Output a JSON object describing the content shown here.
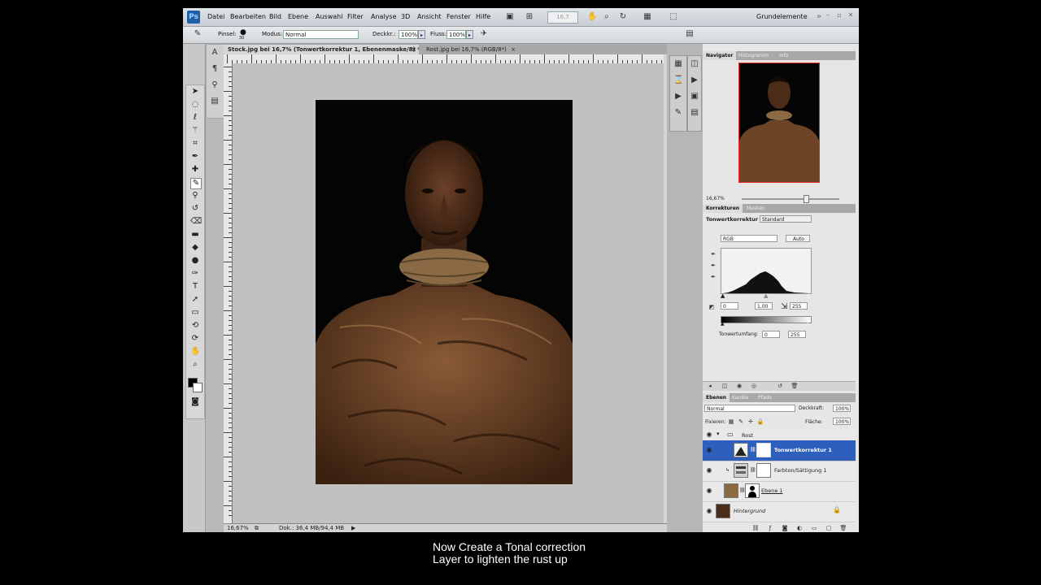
{
  "menubar": {
    "logo": "Ps",
    "items": [
      "Datei",
      "Bearbeiten",
      "Bild",
      "Ebene",
      "Auswahl",
      "Filter",
      "Analyse",
      "3D",
      "Ansicht",
      "Fenster",
      "Hilfe"
    ],
    "zoom_value": "16,7",
    "workspace": "Grundelemente",
    "window_buttons": [
      "–",
      "▫",
      "✕"
    ]
  },
  "options": {
    "tool_label": "Pinsel:",
    "brush_size": "30",
    "mode_label": "Modus:",
    "mode_value": "Normal",
    "opacity_label": "Deckkr.:",
    "opacity_value": "100%",
    "flow_label": "Fluss:",
    "flow_value": "100%"
  },
  "tabs": [
    {
      "label": "Stock.jpg bei 16,7% (Tonwertkorrektur 1, Ebenenmaske/8) *",
      "close": "×"
    },
    {
      "label": "Rost.jpg bei 16,7% (RGB/8*)",
      "close": "×"
    }
  ],
  "status": {
    "zoom": "16,67%",
    "doc": "Dok.: 36,4 MB/94,4 MB"
  },
  "navigator": {
    "tabs": [
      "Navigator",
      "Histogramm",
      "Info"
    ],
    "zoom": "16,67%"
  },
  "adjustments": {
    "tabs": [
      "Korrekturen",
      "Masken"
    ],
    "title": "Tonwertkorrektur",
    "preset": "Standard",
    "channel": "RGB",
    "auto_label": "Auto",
    "input_black": "0",
    "input_gamma": "1,00",
    "input_white": "255",
    "output_label": "Tonwertumfang:",
    "output_black": "0",
    "output_white": "255"
  },
  "layers": {
    "tabs": [
      "Ebenen",
      "Kanäle",
      "Pfade"
    ],
    "blend_mode": "Normal",
    "opacity_label": "Deckkraft:",
    "opacity_value": "100%",
    "lock_label": "Fixieren:",
    "fill_label": "Fläche:",
    "fill_value": "100%",
    "items": [
      {
        "name": "Rost",
        "type": "group"
      },
      {
        "name": "Tonwertkorrektur 1",
        "type": "adjustment",
        "selected": true
      },
      {
        "name": "Farbton/Sättigung 1",
        "type": "adjustment"
      },
      {
        "name": "Ebene 1",
        "type": "pixel"
      },
      {
        "name": "Hintergrund",
        "type": "background"
      }
    ]
  },
  "subtitle": {
    "line1": "Now Create a Tonal correction",
    "line2": "Layer to lighten the rust up"
  },
  "colors": {
    "selection": "#2f5fbd",
    "nav_frame": "#e02a2a"
  }
}
